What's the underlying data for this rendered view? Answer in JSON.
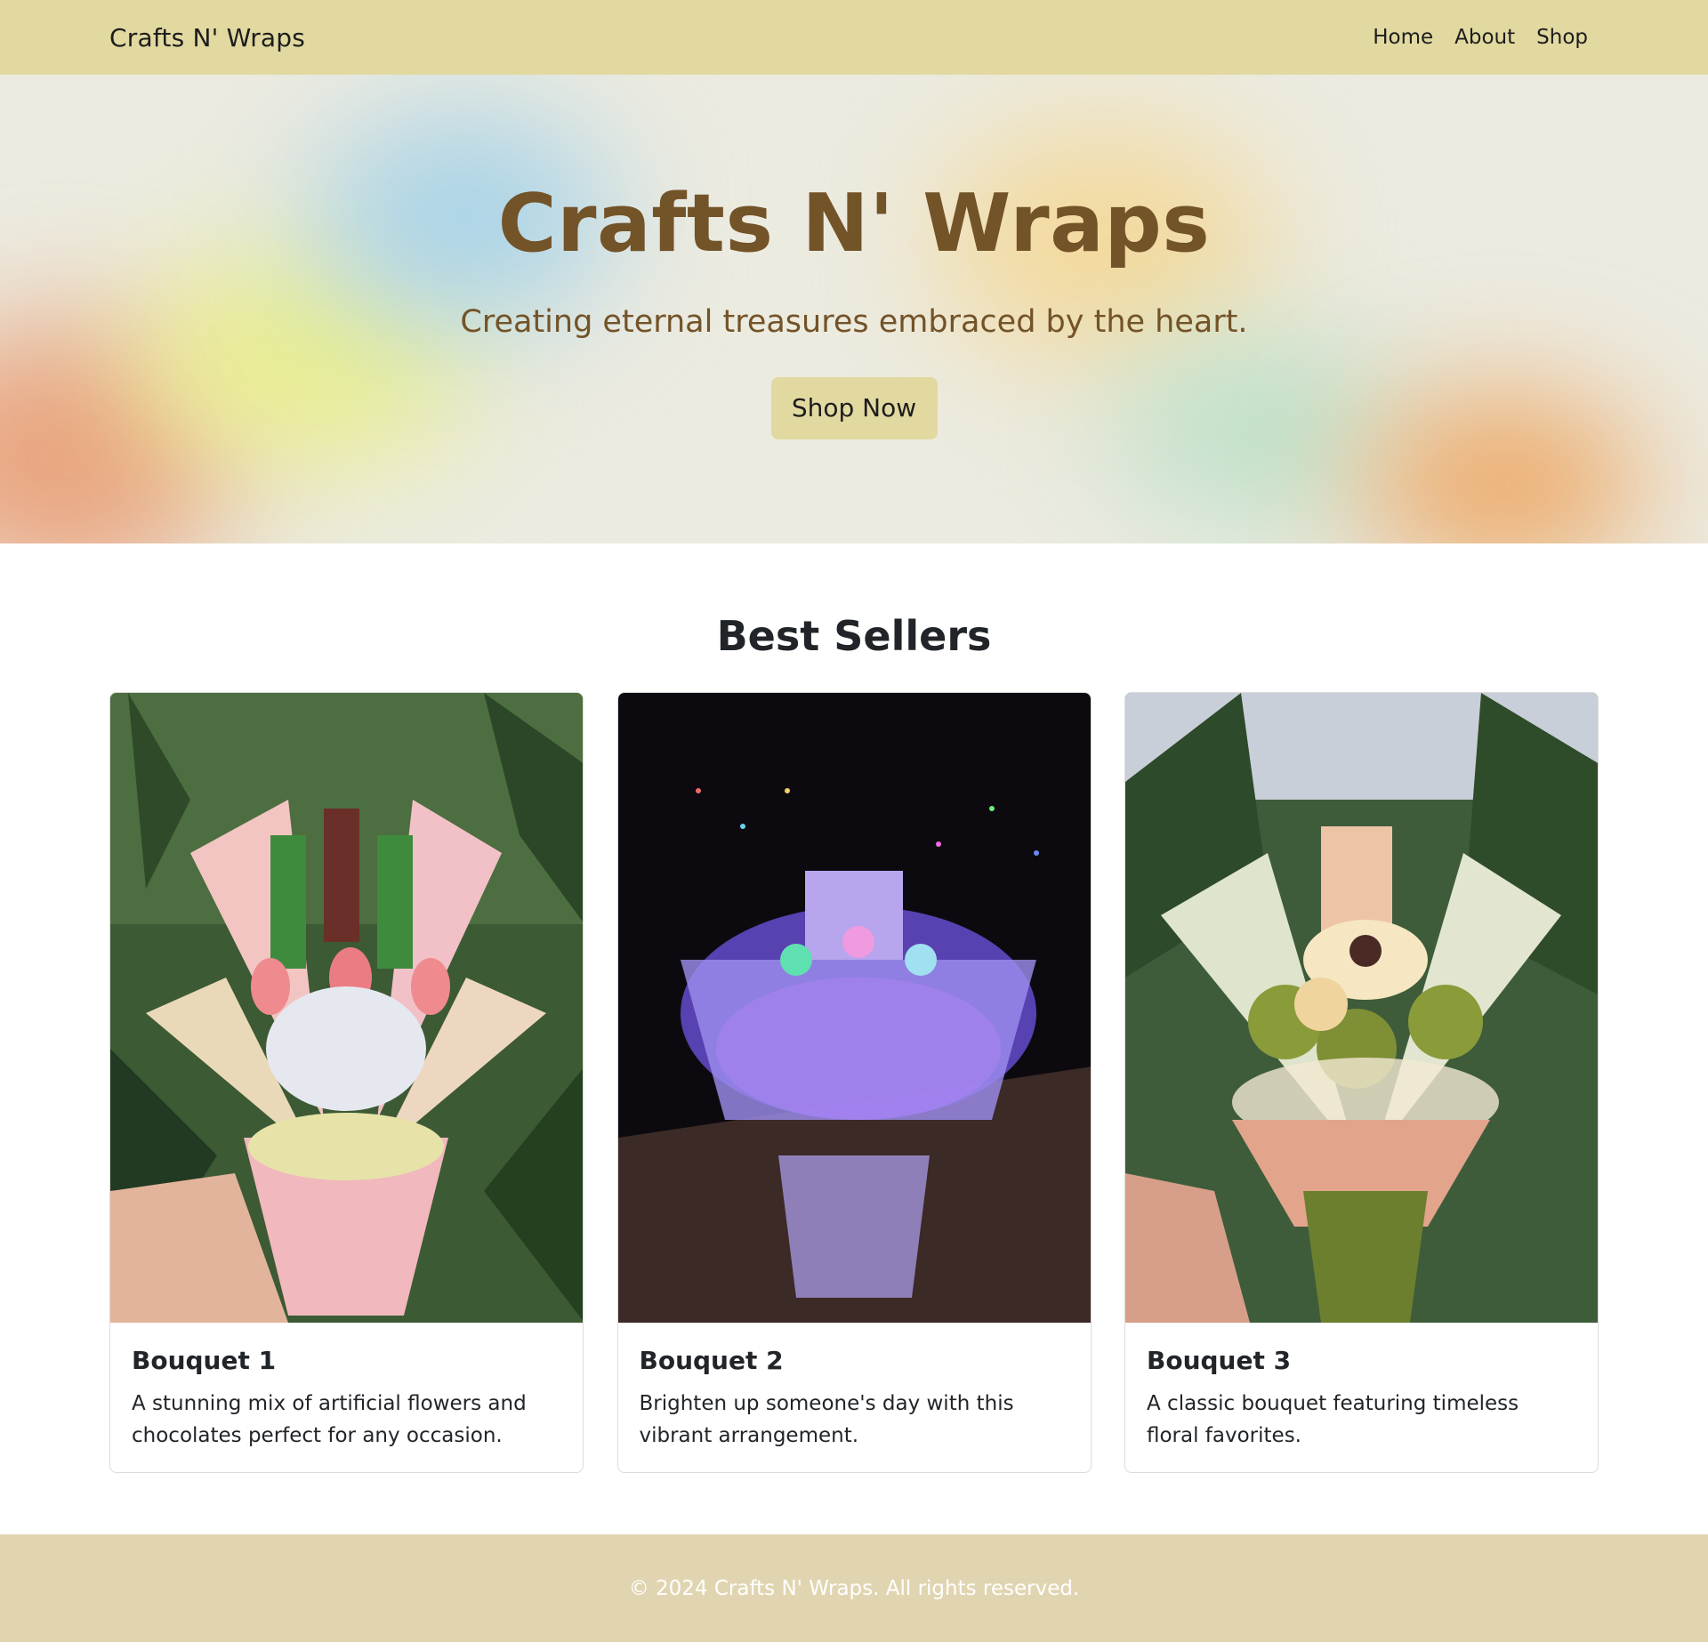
{
  "navbar": {
    "brand": "Crafts N' Wraps",
    "links": [
      "Home",
      "About",
      "Shop"
    ]
  },
  "hero": {
    "title": "Crafts N' Wraps",
    "subtitle": "Creating eternal treasures embraced by the heart.",
    "button_label": "Shop Now"
  },
  "best_sellers": {
    "heading": "Best Sellers",
    "items": [
      {
        "title": "Bouquet 1",
        "description": "A stunning mix of artificial flowers and chocolates perfect for any occasion."
      },
      {
        "title": "Bouquet 2",
        "description": "Brighten up someone's day with this vibrant arrangement."
      },
      {
        "title": "Bouquet 3",
        "description": "A classic bouquet featuring timeless floral favorites."
      }
    ]
  },
  "footer": {
    "text": "© 2024 Crafts N' Wraps. All rights reserved."
  },
  "colors": {
    "navbar_bg": "#e2d9a0",
    "hero_text": "#735328",
    "footer_bg": "#e1d5b1"
  }
}
